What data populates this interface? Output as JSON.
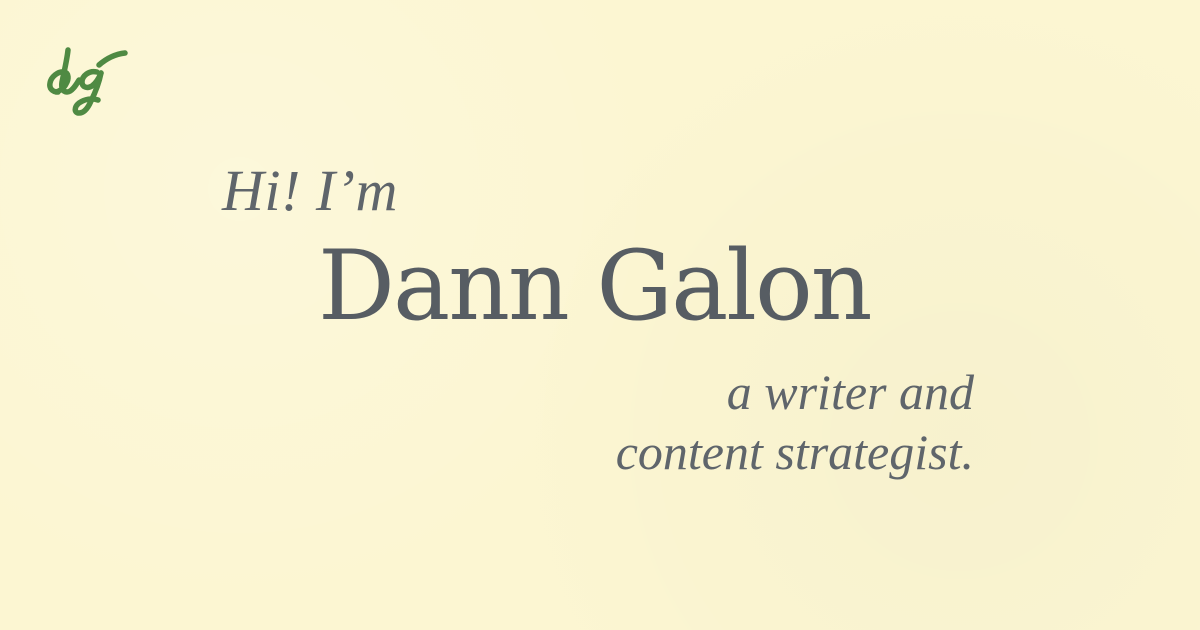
{
  "brand": {
    "logo_text": "dg",
    "logo_color": "#4f8a43"
  },
  "hero": {
    "greeting": "Hi! I’m",
    "name": "Dann Galon",
    "tagline_line1": "a writer and",
    "tagline_line2": "content strategist."
  },
  "colors": {
    "background": "#fcf6d2",
    "text": "#5f656b"
  }
}
